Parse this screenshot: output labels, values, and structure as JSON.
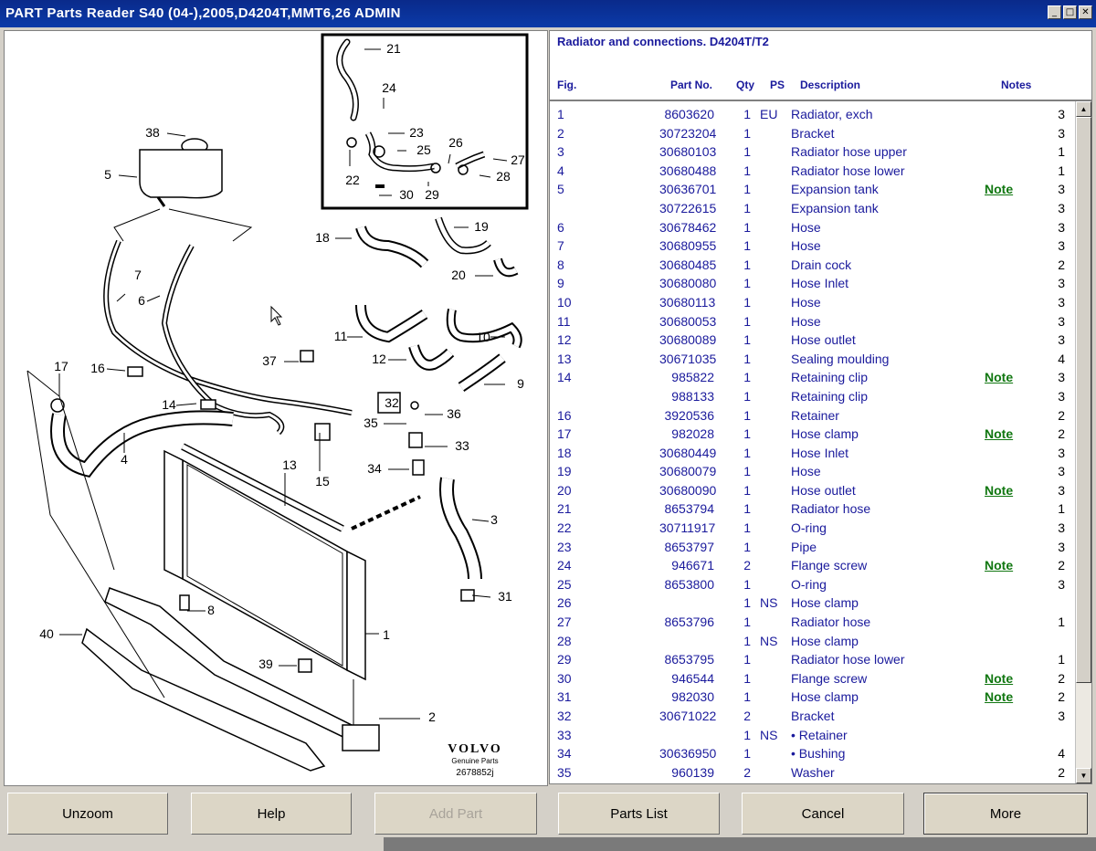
{
  "window": {
    "title": "PART Parts Reader S40 (04-),2005,D4204T,MMT6,26 ADMIN",
    "buttons": [
      "minimize",
      "maximize",
      "close"
    ]
  },
  "diagram": {
    "brand": "VOLVO",
    "brand_sub": "Genuine Parts",
    "ref": "2678852j",
    "callouts": [
      "1",
      "2",
      "3",
      "4",
      "5",
      "6",
      "7",
      "8",
      "9",
      "10",
      "11",
      "12",
      "13",
      "14",
      "15",
      "16",
      "17",
      "18",
      "19",
      "20",
      "21",
      "22",
      "23",
      "24",
      "25",
      "26",
      "27",
      "28",
      "29",
      "30",
      "31",
      "32",
      "33",
      "34",
      "35",
      "36",
      "37",
      "38",
      "39",
      "40"
    ]
  },
  "heading": {
    "title": "Radiator and connections. D4204T/T2",
    "columns": {
      "fig": "Fig.",
      "part": "Part No.",
      "qty": "Qty",
      "ps": "PS",
      "desc": "Description",
      "notes": "Notes"
    }
  },
  "rows": [
    {
      "fig": "1",
      "part": "8603620",
      "qty": "1",
      "ps": "EU",
      "desc": "Radiator, exch",
      "note": "",
      "n": "3"
    },
    {
      "fig": "2",
      "part": "30723204",
      "qty": "1",
      "ps": "",
      "desc": "Bracket",
      "note": "",
      "n": "3"
    },
    {
      "fig": "3",
      "part": "30680103",
      "qty": "1",
      "ps": "",
      "desc": "Radiator hose upper",
      "note": "",
      "n": "1"
    },
    {
      "fig": "4",
      "part": "30680488",
      "qty": "1",
      "ps": "",
      "desc": "Radiator hose lower",
      "note": "",
      "n": "1"
    },
    {
      "fig": "5",
      "part": "30636701",
      "qty": "1",
      "ps": "",
      "desc": "Expansion tank",
      "note": "Note",
      "n": "3"
    },
    {
      "fig": "",
      "part": "30722615",
      "qty": "1",
      "ps": "",
      "desc": "Expansion tank",
      "note": "",
      "n": "3"
    },
    {
      "fig": "6",
      "part": "30678462",
      "qty": "1",
      "ps": "",
      "desc": "Hose",
      "note": "",
      "n": "3"
    },
    {
      "fig": "7",
      "part": "30680955",
      "qty": "1",
      "ps": "",
      "desc": "Hose",
      "note": "",
      "n": "3"
    },
    {
      "fig": "8",
      "part": "30680485",
      "qty": "1",
      "ps": "",
      "desc": "Drain cock",
      "note": "",
      "n": "2"
    },
    {
      "fig": "9",
      "part": "30680080",
      "qty": "1",
      "ps": "",
      "desc": "Hose Inlet",
      "note": "",
      "n": "3"
    },
    {
      "fig": "10",
      "part": "30680113",
      "qty": "1",
      "ps": "",
      "desc": "Hose",
      "note": "",
      "n": "3"
    },
    {
      "fig": "11",
      "part": "30680053",
      "qty": "1",
      "ps": "",
      "desc": "Hose",
      "note": "",
      "n": "3"
    },
    {
      "fig": "12",
      "part": "30680089",
      "qty": "1",
      "ps": "",
      "desc": "Hose outlet",
      "note": "",
      "n": "3"
    },
    {
      "fig": "13",
      "part": "30671035",
      "qty": "1",
      "ps": "",
      "desc": "Sealing moulding",
      "note": "",
      "n": "4"
    },
    {
      "fig": "14",
      "part": "985822",
      "qty": "1",
      "ps": "",
      "desc": "Retaining clip",
      "note": "Note",
      "n": "3"
    },
    {
      "fig": "",
      "part": "988133",
      "qty": "1",
      "ps": "",
      "desc": "Retaining clip",
      "note": "",
      "n": "3"
    },
    {
      "fig": "16",
      "part": "3920536",
      "qty": "1",
      "ps": "",
      "desc": "Retainer",
      "note": "",
      "n": "2"
    },
    {
      "fig": "17",
      "part": "982028",
      "qty": "1",
      "ps": "",
      "desc": "Hose clamp",
      "note": "Note",
      "n": "2"
    },
    {
      "fig": "18",
      "part": "30680449",
      "qty": "1",
      "ps": "",
      "desc": "Hose Inlet",
      "note": "",
      "n": "3"
    },
    {
      "fig": "19",
      "part": "30680079",
      "qty": "1",
      "ps": "",
      "desc": "Hose",
      "note": "",
      "n": "3"
    },
    {
      "fig": "20",
      "part": "30680090",
      "qty": "1",
      "ps": "",
      "desc": "Hose outlet",
      "note": "Note",
      "n": "3"
    },
    {
      "fig": "21",
      "part": "8653794",
      "qty": "1",
      "ps": "",
      "desc": "Radiator hose",
      "note": "",
      "n": "1"
    },
    {
      "fig": "22",
      "part": "30711917",
      "qty": "1",
      "ps": "",
      "desc": "O-ring",
      "note": "",
      "n": "3"
    },
    {
      "fig": "23",
      "part": "8653797",
      "qty": "1",
      "ps": "",
      "desc": "Pipe",
      "note": "",
      "n": "3"
    },
    {
      "fig": "24",
      "part": "946671",
      "qty": "2",
      "ps": "",
      "desc": "Flange screw",
      "note": "Note",
      "n": "2"
    },
    {
      "fig": "25",
      "part": "8653800",
      "qty": "1",
      "ps": "",
      "desc": "O-ring",
      "note": "",
      "n": "3"
    },
    {
      "fig": "26",
      "part": "",
      "qty": "1",
      "ps": "NS",
      "desc": "Hose clamp",
      "note": "",
      "n": ""
    },
    {
      "fig": "27",
      "part": "8653796",
      "qty": "1",
      "ps": "",
      "desc": "Radiator hose",
      "note": "",
      "n": "1"
    },
    {
      "fig": "28",
      "part": "",
      "qty": "1",
      "ps": "NS",
      "desc": "Hose clamp",
      "note": "",
      "n": ""
    },
    {
      "fig": "29",
      "part": "8653795",
      "qty": "1",
      "ps": "",
      "desc": "Radiator hose lower",
      "note": "",
      "n": "1"
    },
    {
      "fig": "30",
      "part": "946544",
      "qty": "1",
      "ps": "",
      "desc": "Flange screw",
      "note": "Note",
      "n": "2"
    },
    {
      "fig": "31",
      "part": "982030",
      "qty": "1",
      "ps": "",
      "desc": "Hose clamp",
      "note": "Note",
      "n": "2"
    },
    {
      "fig": "32",
      "part": "30671022",
      "qty": "2",
      "ps": "",
      "desc": "Bracket",
      "note": "",
      "n": "3"
    },
    {
      "fig": "33",
      "part": "",
      "qty": "1",
      "ps": "NS",
      "desc": "• Retainer",
      "note": "",
      "n": ""
    },
    {
      "fig": "34",
      "part": "30636950",
      "qty": "1",
      "ps": "",
      "desc": "• Bushing",
      "note": "",
      "n": "4"
    },
    {
      "fig": "35",
      "part": "960139",
      "qty": "2",
      "ps": "",
      "desc": "Washer",
      "note": "",
      "n": "2"
    }
  ],
  "buttons": {
    "unzoom": "Unzoom",
    "help": "Help",
    "add_part": "Add Part",
    "parts_list": "Parts List",
    "cancel": "Cancel",
    "more": "More"
  }
}
